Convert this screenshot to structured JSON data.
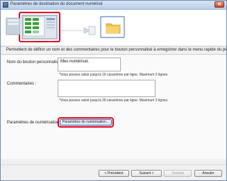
{
  "window": {
    "title": "Paramètres de destination du document numérisé",
    "close_glyph": "✕"
  },
  "header": {
    "steps": [
      "scanner-icon",
      "folder-icon"
    ],
    "accent_color": "#e0001b"
  },
  "intro_text": "Permettent de définir un nom et des commentaires pour le bouton personnalisé à enregistrer dans le menu rapide du périphérique.",
  "form": {
    "button_name": {
      "label": "Nom du bouton personnalisé :",
      "value": "Mes numérisat.",
      "hint": "*Vous pouvez saisir jusqu'à 16 caractères par ligne. Maximum 2 lignes."
    },
    "comments": {
      "label": "Commentaires :",
      "value": "",
      "hint": "*Vous pouvez saisir jusqu'à 26 caractères par ligne. Maximum 3 lignes."
    },
    "scan_settings": {
      "label": "Paramètres de numérisation",
      "button_label": "Paramètres de numérisation..."
    }
  },
  "footer": {
    "back": "< Précédent",
    "next": "Suivant >",
    "finish": "Terminé",
    "cancel": "Annuler"
  }
}
